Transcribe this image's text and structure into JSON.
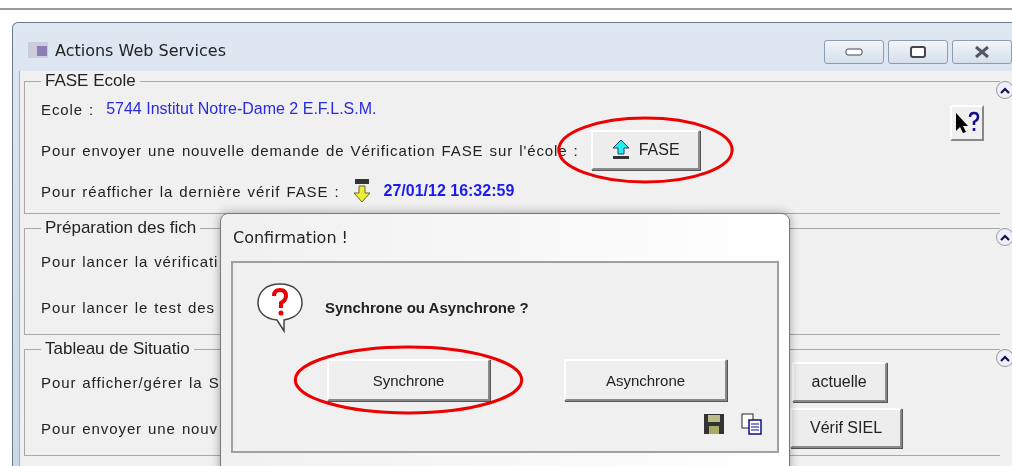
{
  "window": {
    "title": "Actions Web Services"
  },
  "sections": [
    {
      "legend": "FASE Ecole",
      "help": true,
      "rows": [
        {
          "kind": "info",
          "label": "Ecole :",
          "value": "5744 Institut Notre-Dame 2 E.F.L.S.M."
        },
        {
          "kind": "action",
          "label": "Pour envoyer une nouvelle demande de Vérification FASE sur l'école :",
          "button": "FASE",
          "highlighted": true
        },
        {
          "kind": "link",
          "label": "Pour réafficher la dernière vérif FASE :",
          "value": "27/01/12 16:32:59"
        }
      ]
    },
    {
      "legend": "Préparation des fich",
      "help": false,
      "rows": [
        {
          "kind": "text",
          "label": "Pour lancer la vérificati"
        },
        {
          "kind": "text",
          "label": "Pour lancer le test des"
        }
      ]
    },
    {
      "legend": "Tableau de Situatio",
      "help": false,
      "rows": [
        {
          "kind": "far",
          "label": "Pour afficher/gérer la S",
          "button": "actuelle",
          "highlighted": false
        },
        {
          "kind": "far",
          "label": "Pour envoyer une nouv",
          "button": "Vérif SIEL",
          "highlighted": false
        }
      ]
    }
  ],
  "dialog": {
    "title": "Confirmation !",
    "message": "Synchrone ou Asynchrone ?",
    "buttons": [
      {
        "label": "Synchrone",
        "highlighted": true
      },
      {
        "label": "Asynchrone",
        "highlighted": false
      }
    ]
  }
}
